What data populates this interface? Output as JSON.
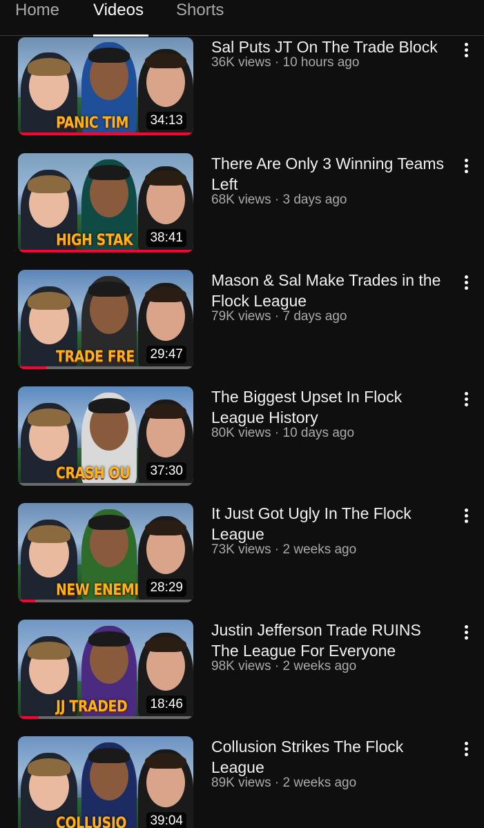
{
  "tabs": [
    {
      "label": "Home"
    },
    {
      "label": "Videos"
    },
    {
      "label": "Shorts"
    }
  ],
  "videos": [
    {
      "title": "Sal Puts JT On The Trade Block",
      "views": "36K views",
      "age": "10 hours ago",
      "duration": "34:13",
      "caption": "PANIC TIM",
      "watched": 1.0,
      "sky": "#6e8fb3",
      "shirt2": "#1f4f99"
    },
    {
      "title": "There Are Only 3 Winning Teams Left",
      "views": "68K views",
      "age": "3 days ago",
      "duration": "38:41",
      "caption": "HIGH STAK",
      "watched": 1.0,
      "sky": "#7b9fbf",
      "shirt2": "#0f4a45"
    },
    {
      "title": "Mason & Sal Make Trades in the Flock League",
      "views": "79K views",
      "age": "7 days ago",
      "duration": "29:47",
      "caption": "TRADE FRE",
      "watched": 0.16,
      "sky": "#5c86b8",
      "shirt2": "#2a2a2a"
    },
    {
      "title": "The Biggest Upset In Flock League History",
      "views": "80K views",
      "age": "10 days ago",
      "duration": "37:30",
      "caption": "CRASH OU",
      "watched": 0.0,
      "sky": "#5c89c0",
      "shirt2": "#d9d9d9"
    },
    {
      "title": "It Just Got Ugly In The Flock League",
      "views": "73K views",
      "age": "2 weeks ago",
      "duration": "28:29",
      "caption": "NEW ENEMI",
      "watched": 0.1,
      "sky": "#6a8db5",
      "shirt2": "#2f6b2a"
    },
    {
      "title": "Justin Jefferson Trade RUINS The League For Everyone",
      "views": "98K views",
      "age": "2 weeks ago",
      "duration": "18:46",
      "caption": "JJ TRADED",
      "watched": 0.12,
      "sky": "#6f96c4",
      "shirt2": "#4b2b80"
    },
    {
      "title": "Collusion Strikes The Flock League",
      "views": "89K views",
      "age": "2 weeks ago",
      "duration": "39:04",
      "caption": "COLLUSIO",
      "watched": 0.0,
      "sky": "#6c93c2",
      "shirt2": "#1c2c63"
    }
  ]
}
